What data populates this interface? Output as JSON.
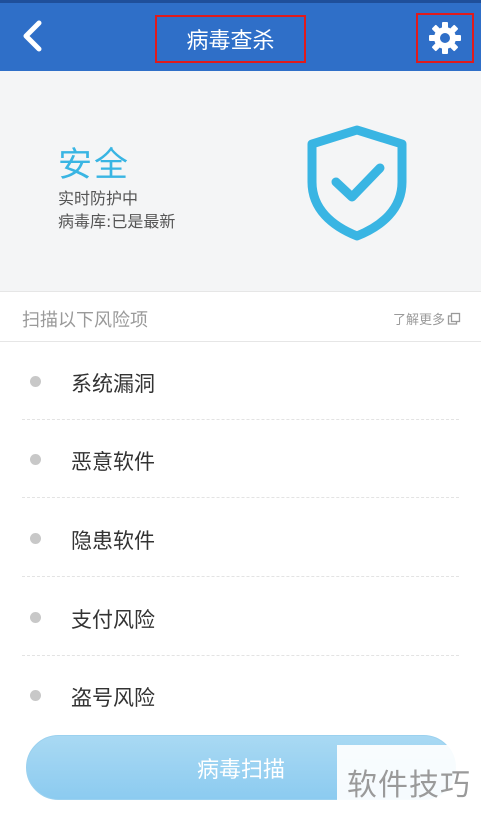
{
  "header": {
    "back_icon": "chevron-left-icon",
    "title": "病毒查杀",
    "settings_icon": "gear-icon"
  },
  "status": {
    "title": "安全",
    "line1": "实时防护中",
    "line2": "病毒库:已是最新",
    "icon": "shield-check-icon",
    "accent_color": "#39b5e3"
  },
  "scan_section": {
    "title": "扫描以下风险项",
    "learn_more": "了解更多"
  },
  "risk_items": [
    {
      "label": "系统漏洞"
    },
    {
      "label": "恶意软件"
    },
    {
      "label": "隐患软件"
    },
    {
      "label": "支付风险"
    },
    {
      "label": "盗号风险"
    }
  ],
  "scan_button": {
    "label": "病毒扫描"
  },
  "watermark": "软件技巧",
  "colors": {
    "topbar": "#2f6fc8",
    "highlight_border": "#e01b1b",
    "button": "#9fd3f2"
  }
}
